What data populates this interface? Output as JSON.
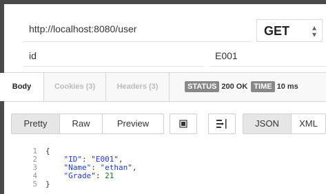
{
  "request": {
    "url": "http://localhost:8080/user",
    "method": "GET",
    "param_key": "id",
    "param_value": "E001"
  },
  "response_tabs": [
    {
      "label": "Body"
    },
    {
      "label": "Cookies (3)"
    },
    {
      "label": "Headers (3)"
    }
  ],
  "status": {
    "status_label": "STATUS",
    "status_value": "200 OK",
    "time_label": "TIME",
    "time_value": "10 ms"
  },
  "toolbar": {
    "view_modes": [
      "Pretty",
      "Raw",
      "Preview"
    ],
    "formats": [
      "JSON",
      "XML"
    ]
  },
  "code": {
    "line_numbers": [
      "1",
      "2",
      "3",
      "4",
      "5"
    ],
    "open_brace": "{",
    "close_brace": "}",
    "fields": [
      {
        "key": "\"ID\"",
        "sep": ": ",
        "value": "\"E001\"",
        "end": ","
      },
      {
        "key": "\"Name\"",
        "sep": ": ",
        "value": "\"ethan\"",
        "end": ","
      },
      {
        "key": "\"Grade\"",
        "sep": ": ",
        "value": "21",
        "end": ""
      }
    ]
  },
  "colors": {
    "json_key": "#1d3bd7",
    "json_number": "#187a18",
    "badge_bg": "#888888"
  }
}
